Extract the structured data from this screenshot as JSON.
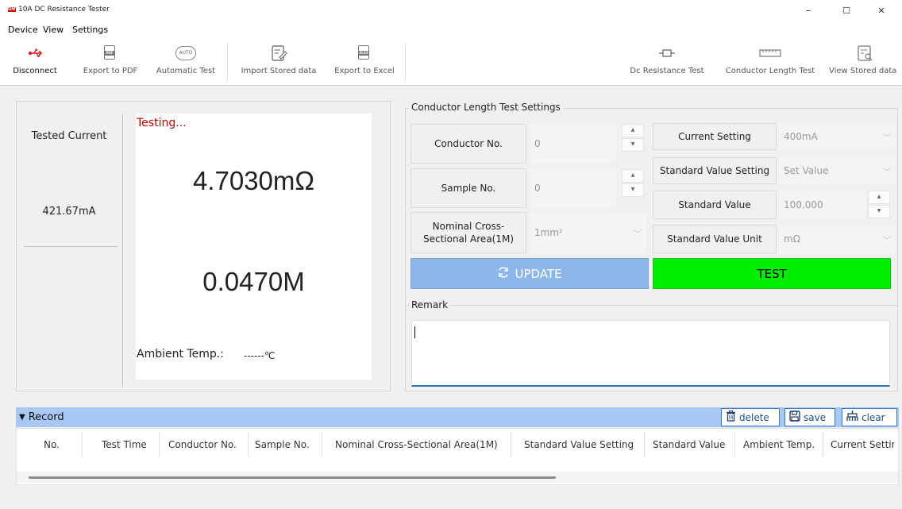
{
  "window": {
    "logo": "DMT",
    "title": "10A DC Resistance Tester",
    "controls": {
      "minimize": "–",
      "maximize": "☐",
      "close": "✕"
    }
  },
  "menu": [
    "Device",
    "View",
    "Settings"
  ],
  "toolbar": {
    "left": [
      {
        "label": "Disconnect",
        "icon": "usb-icon",
        "icon_text": ""
      },
      {
        "label": "Export to PDF",
        "icon": "pdf-icon",
        "icon_text": "PDF"
      },
      {
        "label": "Automatic Test",
        "icon": "auto-icon",
        "icon_text": "AUTO"
      },
      {
        "label": "Import Stored data",
        "icon": "import-icon",
        "icon_text": ""
      },
      {
        "label": "Export to Excel",
        "icon": "xlsx-icon",
        "icon_text": "XLSX"
      }
    ],
    "right": [
      {
        "label": "Dc Resistance Test",
        "icon": "resistor-icon"
      },
      {
        "label": "Conductor Length Test",
        "icon": "ruler-icon"
      },
      {
        "label": "View Stored data",
        "icon": "view-data-icon"
      }
    ]
  },
  "measure": {
    "tested_current_label": "Tested Current",
    "tested_current_value": "421.67mA",
    "status": "Testing...",
    "resistance": "4.7030mΩ",
    "length": "0.0470M",
    "ambient_label": "Ambient Temp.:",
    "ambient_value": "------℃"
  },
  "settings": {
    "title": "Conductor Length Test Settings",
    "conductor_no": {
      "label": "Conductor No.",
      "value": "0"
    },
    "sample_no": {
      "label": "Sample No.",
      "value": "0"
    },
    "cross_section": {
      "label": "Nominal Cross-Sectional Area(1M)",
      "value": "1mm²"
    },
    "current_setting": {
      "label": "Current Setting",
      "value": "400mA"
    },
    "standard_value_setting": {
      "label": "Standard Value Setting",
      "value": "Set Value"
    },
    "standard_value": {
      "label": "Standard Value",
      "value": "100.000"
    },
    "standard_value_unit": {
      "label": "Standard Value Unit",
      "value": "mΩ"
    },
    "update_label": "UPDATE",
    "test_label": "TEST"
  },
  "remark": {
    "title": "Remark",
    "text": ""
  },
  "record": {
    "title": "Record",
    "buttons": {
      "delete": "delete",
      "save": "save",
      "clear": "clear"
    },
    "columns": [
      "No.",
      "Test Time",
      "Conductor No.",
      "Sample No.",
      "Nominal Cross-Sectional Area(1M)",
      "Standard Value Setting",
      "Standard Value",
      "Ambient Temp.",
      "Current Settir"
    ]
  },
  "colors": {
    "status": "#c00000",
    "test_button": "#00ee00",
    "update_button": "#8db6ea",
    "record_bar": "#a7c8f3"
  }
}
